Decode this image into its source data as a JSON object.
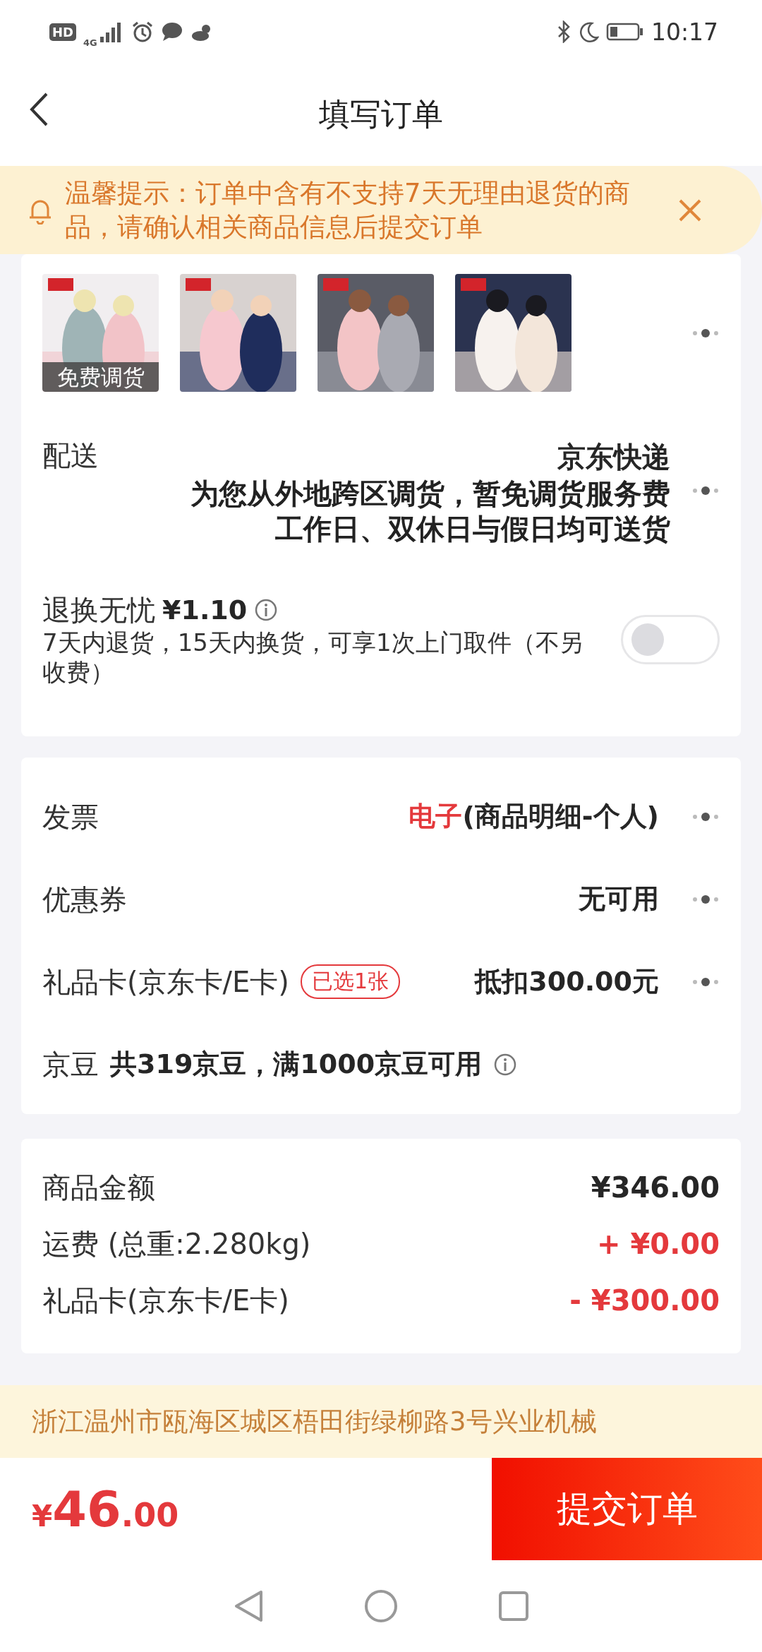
{
  "status_bar": {
    "hd_label": "HD",
    "network": "4G",
    "time": "10:17"
  },
  "header": {
    "title": "填写订单"
  },
  "notice": {
    "text": "温馨提示：订单中含有不支持7天无理由退货的商品，请确认相关商品信息后提交订单"
  },
  "products": [
    {
      "kind": "picture",
      "badge": "免费调货"
    },
    {
      "kind": "picture"
    },
    {
      "kind": "picture"
    },
    {
      "kind": "picture"
    }
  ],
  "delivery": {
    "label": "配送",
    "carrier": "京东快递",
    "notes": [
      "为您从外地跨区调货，暂免调货服务费",
      "工作日、双休日与假日均可送货"
    ]
  },
  "return_service": {
    "label": "退换无忧",
    "price": "¥1.10",
    "description": "7天内退货，15天内换货，可享1次上门取件（不另收费）",
    "on": false
  },
  "options": [
    {
      "kind": "invoice",
      "label": "发票",
      "value_highlight": "电子",
      "value": "(商品明细-个人)"
    },
    {
      "kind": "coupon",
      "label": "优惠券",
      "value": "无可用"
    },
    {
      "kind": "giftcard",
      "label": "礼品卡(京东卡/E卡)",
      "tag": "已选1张",
      "value": "抵扣300.00元"
    },
    {
      "kind": "beans",
      "label": "京豆",
      "value": "共319京豆，满1000京豆可用"
    }
  ],
  "summary": [
    {
      "label": "商品金额",
      "amount": "¥346.00",
      "color": "#262626"
    },
    {
      "label": "运费 (总重:2.280kg)",
      "amount": "+ ¥0.00",
      "color": "#e4393c"
    },
    {
      "label": "礼品卡(京东卡/E卡)",
      "amount": "- ¥300.00",
      "color": "#e4393c"
    }
  ],
  "address": "浙江温州市瓯海区城区梧田街绿柳路3号兴业机械",
  "footer": {
    "currency": "¥",
    "total_integer": "46",
    "total_decimal": ".00",
    "submit": "提交订单"
  }
}
